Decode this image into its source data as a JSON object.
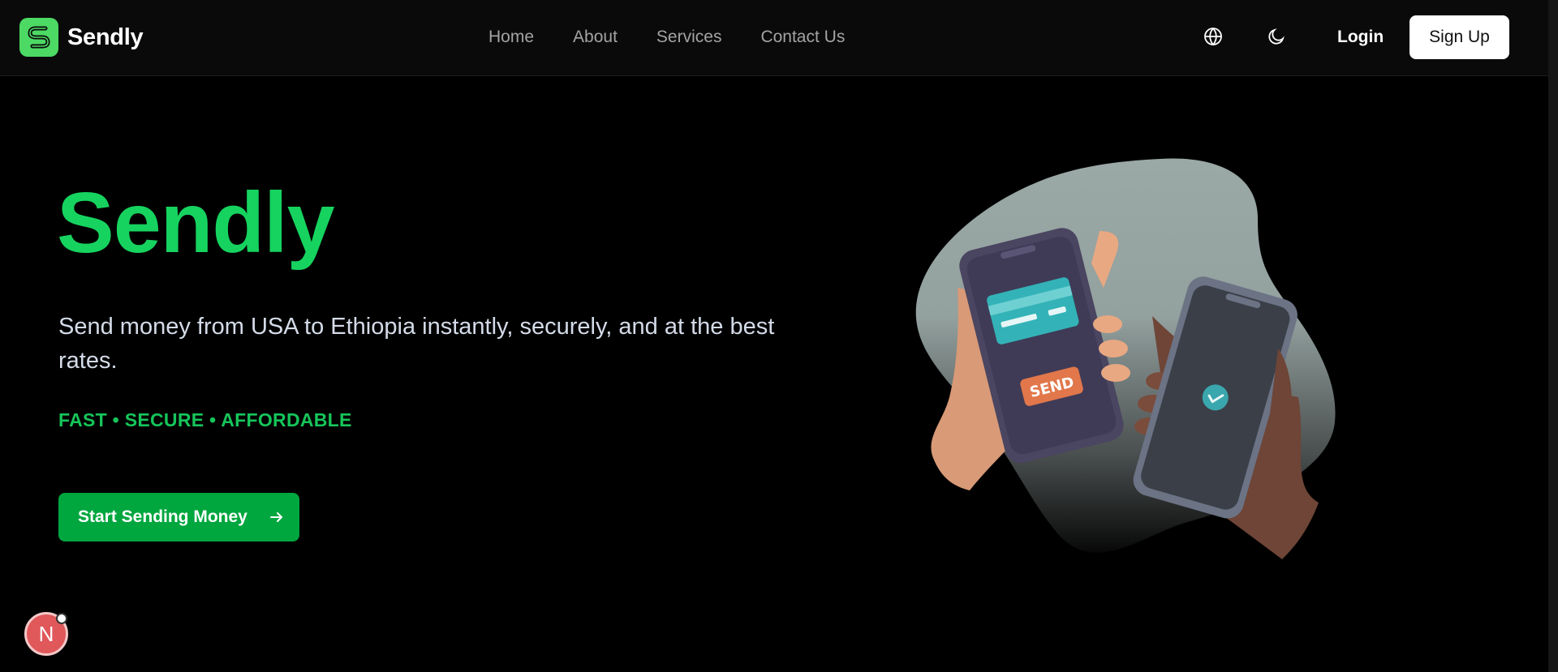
{
  "header": {
    "brand": "Sendly",
    "nav": [
      "Home",
      "About",
      "Services",
      "Contact Us"
    ],
    "login_label": "Login",
    "signup_label": "Sign Up"
  },
  "hero": {
    "title": "Sendly",
    "subtitle": "Send money from USA to Ethiopia instantly, securely, and at the best rates.",
    "tagline": "FAST • SECURE • AFFORDABLE",
    "cta_label": "Start Sending Money",
    "illustration": {
      "send_label": "SEND"
    }
  },
  "dev_badge": {
    "letter": "N"
  },
  "colors": {
    "accent": "#16d35f",
    "cta": "#00a63e",
    "logo": "#4cd964",
    "background": "#000000"
  },
  "icons": {
    "logo": "sendly-logo-icon",
    "language": "globe-icon",
    "theme": "moon-icon",
    "cta_arrow": "arrow-right-icon"
  }
}
